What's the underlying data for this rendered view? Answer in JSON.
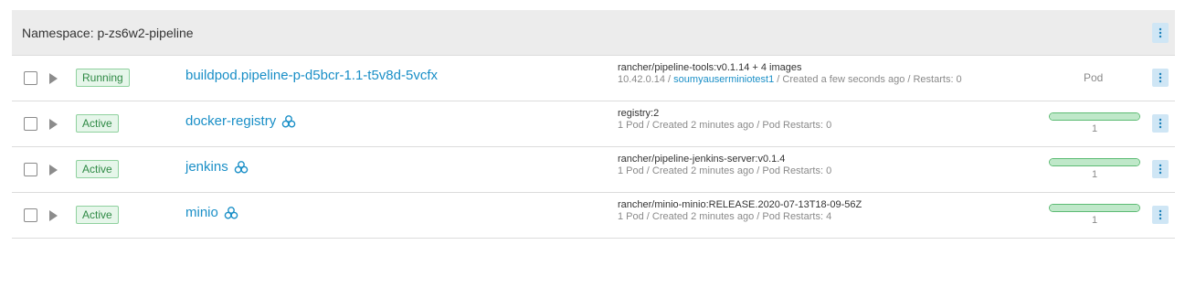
{
  "namespace": {
    "label": "Namespace: p-zs6w2-pipeline"
  },
  "rows": [
    {
      "state": "Running",
      "name": "buildpod.pipeline-p-d5bcr-1.1-t5v8d-5vcfx",
      "image": "rancher/pipeline-tools:v0.1.14 + 4 images",
      "detail_prefix": "10.42.0.14 / ",
      "detail_link": "soumyauserminiotest1",
      "detail_suffix": " / Created a few seconds ago / Restarts: 0",
      "kind": "Pod"
    },
    {
      "state": "Active",
      "name": "docker-registry",
      "icon": "workload-icon",
      "image": "registry:2",
      "detail": "1 Pod / Created 2 minutes ago / Pod Restarts: 0",
      "scale": "1",
      "scale_fraction": 1.0
    },
    {
      "state": "Active",
      "name": "jenkins",
      "icon": "workload-icon",
      "image": "rancher/pipeline-jenkins-server:v0.1.4",
      "detail": "1 Pod / Created 2 minutes ago / Pod Restarts: 0",
      "scale": "1",
      "scale_fraction": 1.0
    },
    {
      "state": "Active",
      "name": "minio",
      "icon": "workload-icon",
      "image": "rancher/minio-minio:RELEASE.2020-07-13T18-09-56Z",
      "detail": "1 Pod / Created 2 minutes ago / Pod Restarts: 4",
      "scale": "1",
      "scale_fraction": 1.0
    }
  ],
  "colors": {
    "link": "#1a8fc7",
    "badge_bg": "#e6f6ea",
    "badge_border": "#8fd19e",
    "header_bg": "#ececec",
    "kebab_bg": "#cfe6f5"
  },
  "icons": {
    "actions": "vertical-dots-icon",
    "expand": "play-triangle-icon"
  }
}
